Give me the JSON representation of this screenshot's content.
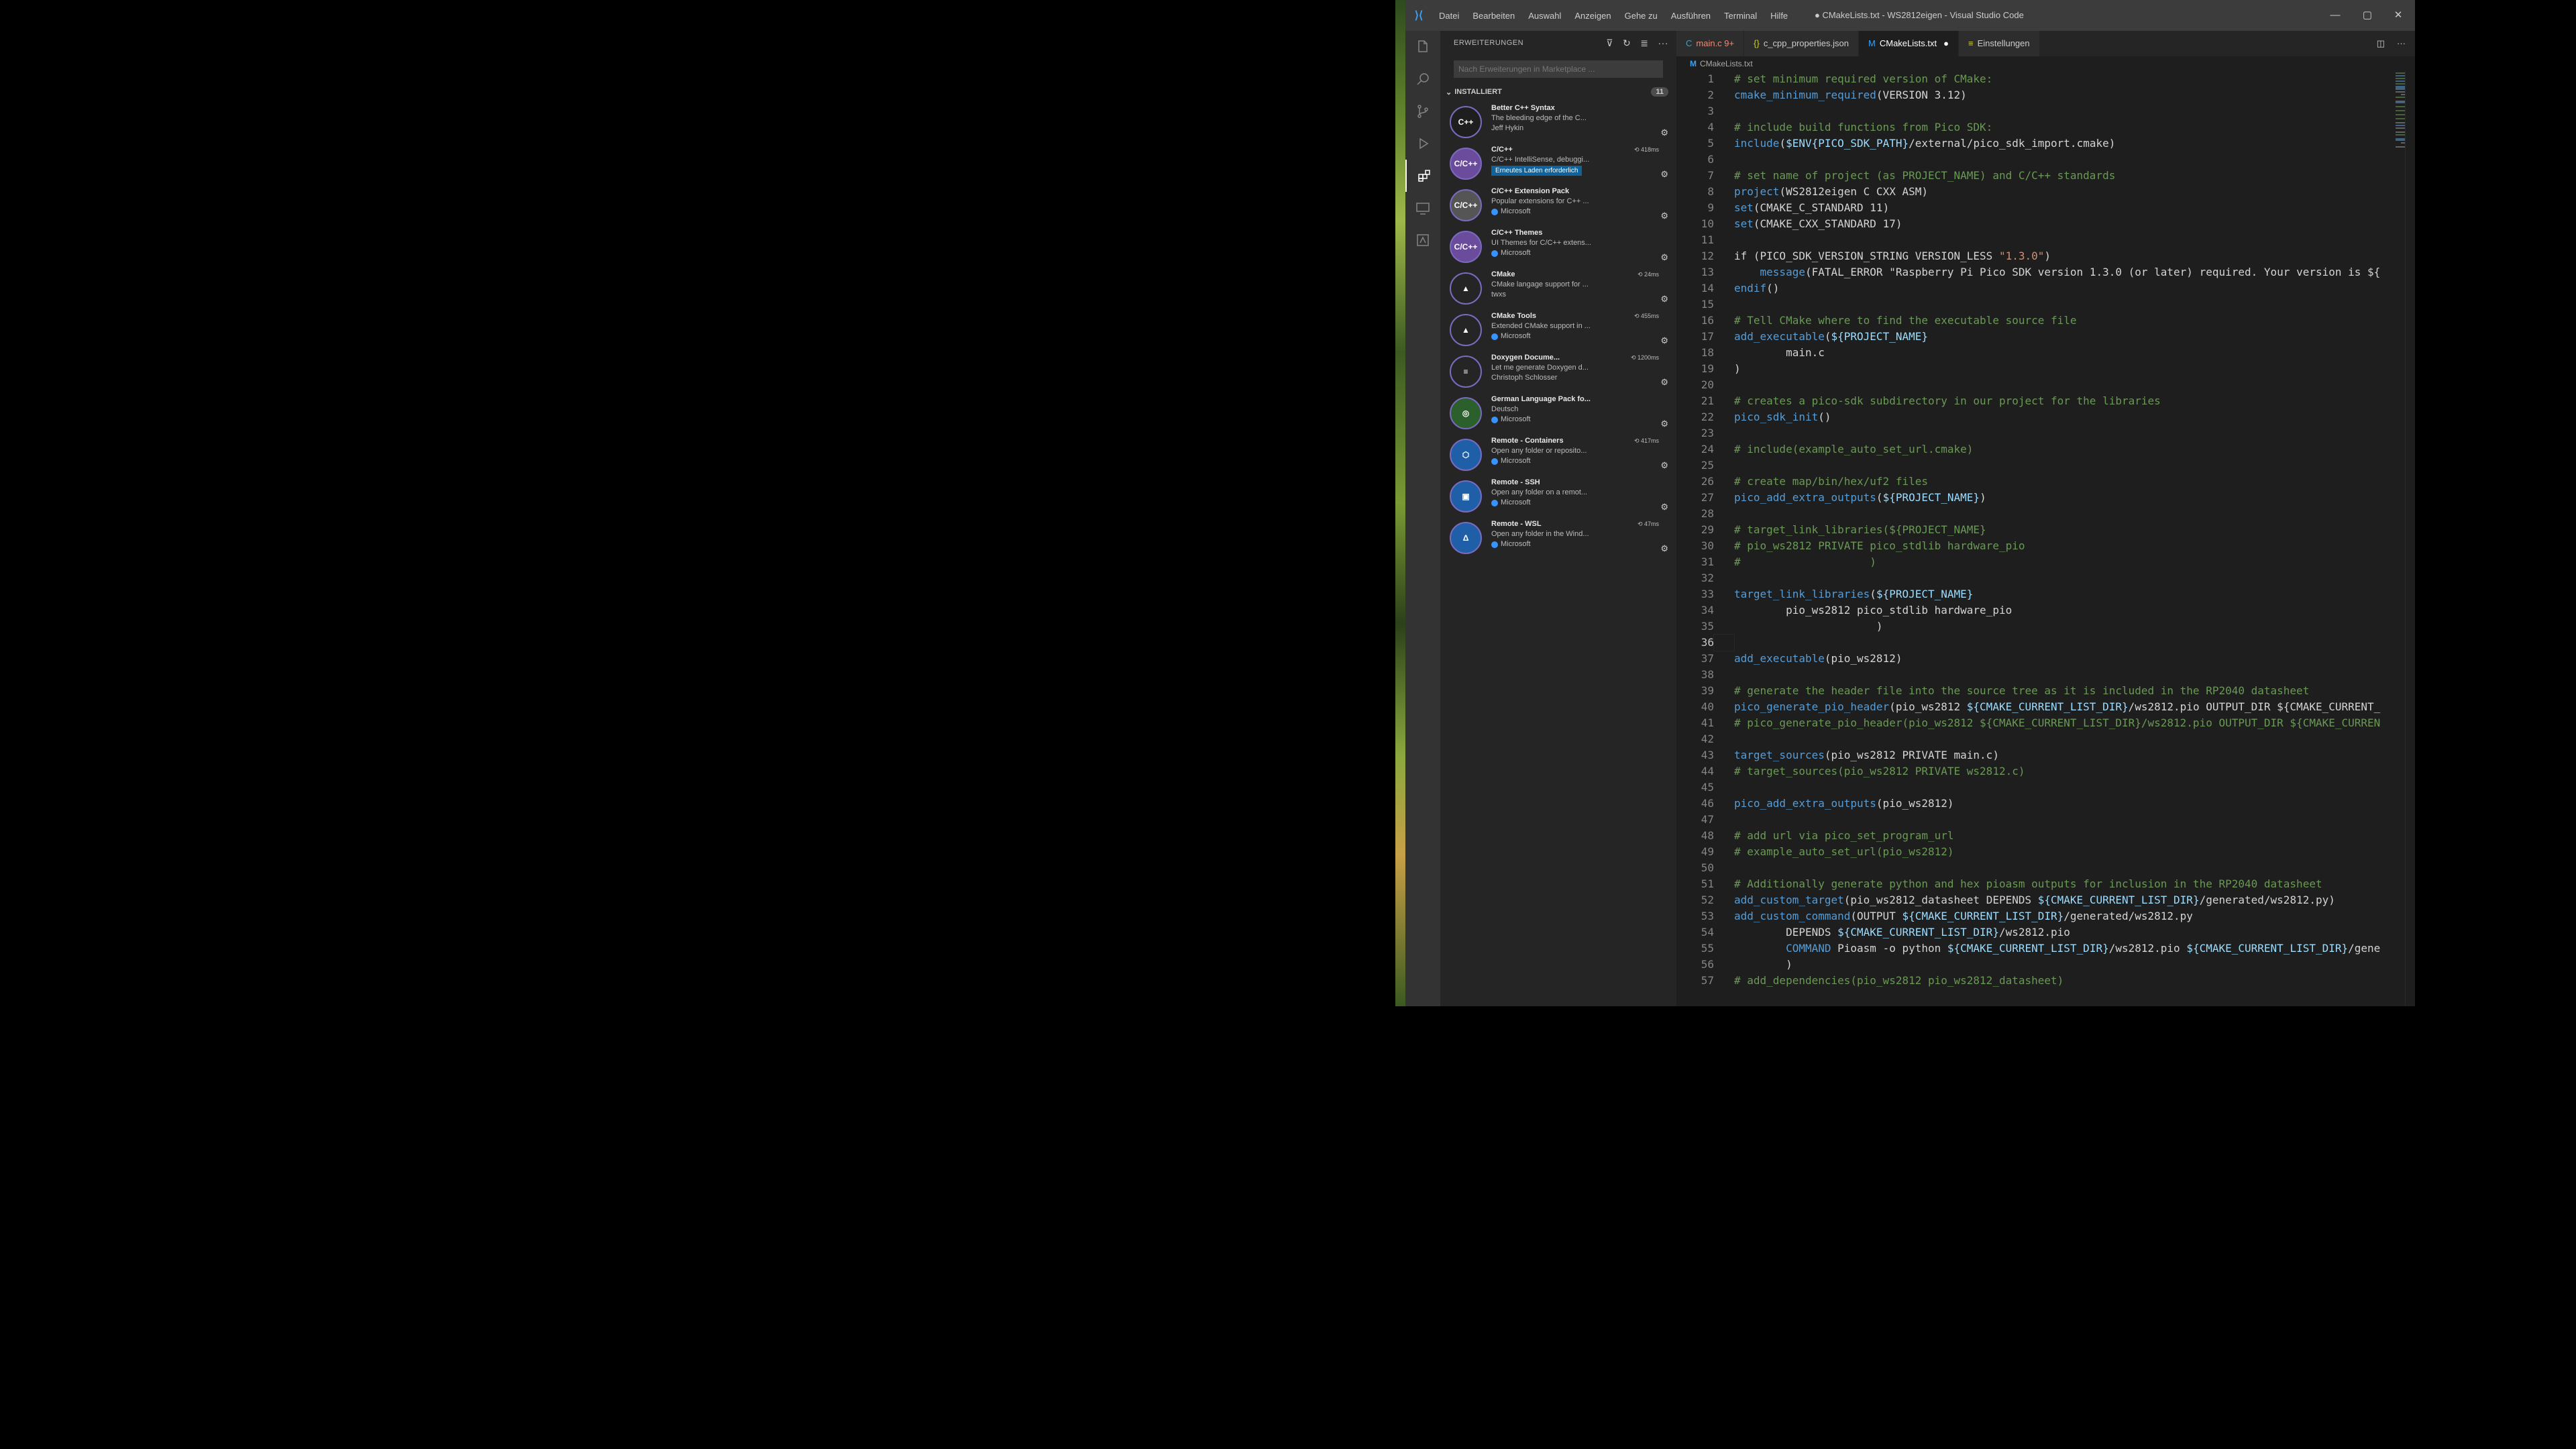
{
  "window": {
    "title": "● CMakeLists.txt - WS2812eigen - Visual Studio Code",
    "menu": [
      "Datei",
      "Bearbeiten",
      "Auswahl",
      "Anzeigen",
      "Gehe zu",
      "Ausführen",
      "Terminal",
      "Hilfe"
    ]
  },
  "sidebar": {
    "header": "ERWEITERUNGEN",
    "search_placeholder": "Nach Erweiterungen in Marketplace ...",
    "section": "INSTALLIERT",
    "count": "11",
    "extensions": [
      {
        "name": "Better C++ Syntax",
        "meta": "",
        "desc": "The bleeding edge of the C...",
        "publisher": "Jeff Hykin",
        "verified": false,
        "badge": "",
        "icon": "C++",
        "color": "#1e1e1e"
      },
      {
        "name": "C/C++",
        "meta": "⟲ 418ms",
        "desc": "C/C++ IntelliSense, debuggi...",
        "publisher": "",
        "verified": false,
        "badge": "Erneutes Laden erforderlich",
        "icon": "C/C++",
        "color": "#6a4b9c"
      },
      {
        "name": "C/C++ Extension Pack",
        "meta": "",
        "desc": "Popular extensions for C++ ...",
        "publisher": "Microsoft",
        "verified": true,
        "badge": "",
        "icon": "C/C++",
        "color": "#555555"
      },
      {
        "name": "C/C++ Themes",
        "meta": "",
        "desc": "UI Themes for C/C++ extens...",
        "publisher": "Microsoft",
        "verified": true,
        "badge": "",
        "icon": "C/C++",
        "color": "#6a4b9c"
      },
      {
        "name": "CMake",
        "meta": "⟲ 24ms",
        "desc": "CMake langage support for ...",
        "publisher": "twxs",
        "verified": false,
        "badge": "",
        "icon": "▲",
        "color": "#252526"
      },
      {
        "name": "CMake Tools",
        "meta": "⟲ 455ms",
        "desc": "Extended CMake support in ...",
        "publisher": "Microsoft",
        "verified": true,
        "badge": "",
        "icon": "▲",
        "color": "#252526"
      },
      {
        "name": "Doxygen Docume...",
        "meta": "⟲ 1200ms",
        "desc": "Let me generate Doxygen d...",
        "publisher": "Christoph Schlosser",
        "verified": false,
        "badge": "",
        "icon": "≡",
        "color": "#252526"
      },
      {
        "name": "German Language Pack fo...",
        "meta": "",
        "desc": "Deutsch",
        "publisher": "Microsoft",
        "verified": true,
        "badge": "",
        "icon": "◎",
        "color": "#2b5f2b"
      },
      {
        "name": "Remote - Containers",
        "meta": "⟲ 417ms",
        "desc": "Open any folder or reposito...",
        "publisher": "Microsoft",
        "verified": true,
        "badge": "",
        "icon": "⬡",
        "color": "#1f5fa8"
      },
      {
        "name": "Remote - SSH",
        "meta": "",
        "desc": "Open any folder on a remot...",
        "publisher": "Microsoft",
        "verified": true,
        "badge": "",
        "icon": "▣",
        "color": "#1f5fa8"
      },
      {
        "name": "Remote - WSL",
        "meta": "⟲ 47ms",
        "desc": "Open any folder in the Wind...",
        "publisher": "Microsoft",
        "verified": true,
        "badge": "",
        "icon": "Δ",
        "color": "#1f5fa8"
      }
    ]
  },
  "tabs": [
    {
      "label": "main.c 9+",
      "icon": "C",
      "active": false,
      "color": "#f48771"
    },
    {
      "label": "c_cpp_properties.json",
      "icon": "{}",
      "active": false,
      "color": "#cccccc"
    },
    {
      "label": "CMakeLists.txt",
      "icon": "M",
      "active": true,
      "color": "#ffffff"
    },
    {
      "label": "Einstellungen",
      "icon": "≡",
      "active": false,
      "color": "#cccccc"
    }
  ],
  "breadcrumb": "CMakeLists.txt",
  "code": [
    "# set minimum required version of CMake:",
    "cmake_minimum_required(VERSION 3.12)",
    "",
    "# include build functions from Pico SDK:",
    "include($ENV{PICO_SDK_PATH}/external/pico_sdk_import.cmake)",
    "",
    "# set name of project (as PROJECT_NAME) and C/C++ standards",
    "project(WS2812eigen C CXX ASM)",
    "set(CMAKE_C_STANDARD 11)",
    "set(CMAKE_CXX_STANDARD 17)",
    "",
    "if (PICO_SDK_VERSION_STRING VERSION_LESS \"1.3.0\")",
    "    message(FATAL_ERROR \"Raspberry Pi Pico SDK version 1.3.0 (or later) required. Your version is ${",
    "endif()",
    "",
    "# Tell CMake where to find the executable source file",
    "add_executable(${PROJECT_NAME}",
    "        main.c",
    ")",
    "",
    "# creates a pico-sdk subdirectory in our project for the libraries",
    "pico_sdk_init()",
    "",
    "# include(example_auto_set_url.cmake)",
    "",
    "# create map/bin/hex/uf2 files",
    "pico_add_extra_outputs(${PROJECT_NAME})",
    "",
    "# target_link_libraries(${PROJECT_NAME}",
    "# pio_ws2812 PRIVATE pico_stdlib hardware_pio",
    "#                    )",
    "",
    "target_link_libraries(${PROJECT_NAME}",
    "        pio_ws2812 pico_stdlib hardware_pio",
    "                      )",
    "",
    "add_executable(pio_ws2812)",
    "",
    "# generate the header file into the source tree as it is included in the RP2040 datasheet",
    "pico_generate_pio_header(pio_ws2812 ${CMAKE_CURRENT_LIST_DIR}/ws2812.pio OUTPUT_DIR ${CMAKE_CURRENT_",
    "# pico_generate_pio_header(pio_ws2812 ${CMAKE_CURRENT_LIST_DIR}/ws2812.pio OUTPUT_DIR ${CMAKE_CURREN",
    "",
    "target_sources(pio_ws2812 PRIVATE main.c)",
    "# target_sources(pio_ws2812 PRIVATE ws2812.c)",
    "",
    "pico_add_extra_outputs(pio_ws2812)",
    "",
    "# add url via pico_set_program_url",
    "# example_auto_set_url(pio_ws2812)",
    "",
    "# Additionally generate python and hex pioasm outputs for inclusion in the RP2040 datasheet",
    "add_custom_target(pio_ws2812_datasheet DEPENDS ${CMAKE_CURRENT_LIST_DIR}/generated/ws2812.py)",
    "add_custom_command(OUTPUT ${CMAKE_CURRENT_LIST_DIR}/generated/ws2812.py",
    "        DEPENDS ${CMAKE_CURRENT_LIST_DIR}/ws2812.pio",
    "        COMMAND Pioasm -o python ${CMAKE_CURRENT_LIST_DIR}/ws2812.pio ${CMAKE_CURRENT_LIST_DIR}/gene",
    "        )",
    "# add_dependencies(pio_ws2812 pio_ws2812_datasheet)"
  ],
  "current_line": 36
}
